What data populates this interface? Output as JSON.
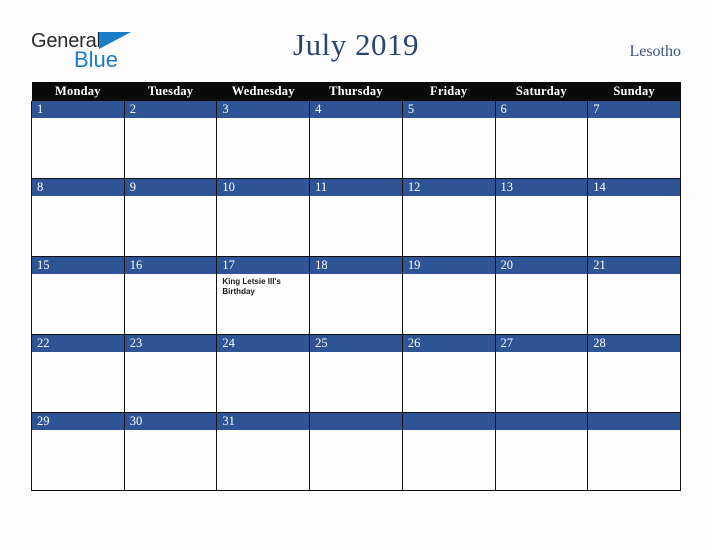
{
  "brand": {
    "word1": "General",
    "word2": "Blue",
    "triangle_color": "#1b7cc9",
    "text_color": "#2b2b2b"
  },
  "header": {
    "title": "July 2019",
    "country": "Lesotho",
    "title_color": "#2b4570"
  },
  "calendar": {
    "weekday_headers": [
      "Monday",
      "Tuesday",
      "Wednesday",
      "Thursday",
      "Friday",
      "Saturday",
      "Sunday"
    ],
    "header_bg": "#0a0a0a",
    "daybar_bg": "#2f5496",
    "cell_bg": "#fdfdfd",
    "grid_color": "#111111",
    "weeks": [
      {
        "days": [
          {
            "date": "1",
            "events": []
          },
          {
            "date": "2",
            "events": []
          },
          {
            "date": "3",
            "events": []
          },
          {
            "date": "4",
            "events": []
          },
          {
            "date": "5",
            "events": []
          },
          {
            "date": "6",
            "events": []
          },
          {
            "date": "7",
            "events": []
          }
        ]
      },
      {
        "days": [
          {
            "date": "8",
            "events": []
          },
          {
            "date": "9",
            "events": []
          },
          {
            "date": "10",
            "events": []
          },
          {
            "date": "11",
            "events": []
          },
          {
            "date": "12",
            "events": []
          },
          {
            "date": "13",
            "events": []
          },
          {
            "date": "14",
            "events": []
          }
        ]
      },
      {
        "days": [
          {
            "date": "15",
            "events": []
          },
          {
            "date": "16",
            "events": []
          },
          {
            "date": "17",
            "events": [
              "King Letsie III's Birthday"
            ]
          },
          {
            "date": "18",
            "events": []
          },
          {
            "date": "19",
            "events": []
          },
          {
            "date": "20",
            "events": []
          },
          {
            "date": "21",
            "events": []
          }
        ]
      },
      {
        "days": [
          {
            "date": "22",
            "events": []
          },
          {
            "date": "23",
            "events": []
          },
          {
            "date": "24",
            "events": []
          },
          {
            "date": "25",
            "events": []
          },
          {
            "date": "26",
            "events": []
          },
          {
            "date": "27",
            "events": []
          },
          {
            "date": "28",
            "events": []
          }
        ]
      },
      {
        "days": [
          {
            "date": "29",
            "events": []
          },
          {
            "date": "30",
            "events": []
          },
          {
            "date": "31",
            "events": []
          },
          {
            "date": "",
            "events": []
          },
          {
            "date": "",
            "events": []
          },
          {
            "date": "",
            "events": []
          },
          {
            "date": "",
            "events": []
          }
        ]
      }
    ]
  }
}
